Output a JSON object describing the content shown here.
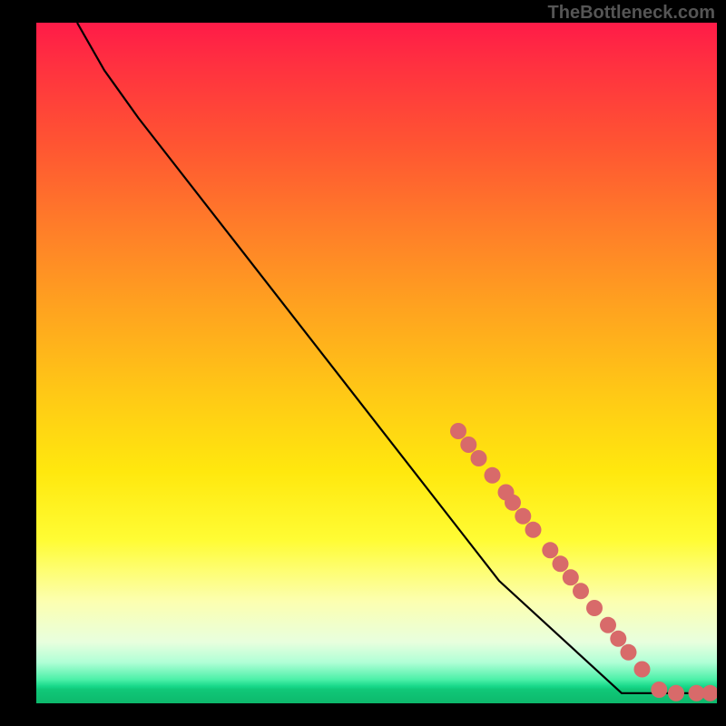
{
  "watermark": "TheBottleneck.com",
  "chart_data": {
    "type": "line",
    "title": "",
    "xlabel": "",
    "ylabel": "",
    "xlim": [
      0,
      100
    ],
    "ylim": [
      0,
      100
    ],
    "curve": [
      {
        "x": 6,
        "y": 100
      },
      {
        "x": 10,
        "y": 93
      },
      {
        "x": 15,
        "y": 86
      },
      {
        "x": 68,
        "y": 18
      },
      {
        "x": 86,
        "y": 1.5
      },
      {
        "x": 100,
        "y": 1.5
      }
    ],
    "markers": [
      {
        "x": 62,
        "y": 40
      },
      {
        "x": 63.5,
        "y": 38
      },
      {
        "x": 65,
        "y": 36
      },
      {
        "x": 67,
        "y": 33.5
      },
      {
        "x": 69,
        "y": 31
      },
      {
        "x": 70,
        "y": 29.5
      },
      {
        "x": 71.5,
        "y": 27.5
      },
      {
        "x": 73,
        "y": 25.5
      },
      {
        "x": 75.5,
        "y": 22.5
      },
      {
        "x": 77,
        "y": 20.5
      },
      {
        "x": 78.5,
        "y": 18.5
      },
      {
        "x": 80,
        "y": 16.5
      },
      {
        "x": 82,
        "y": 14
      },
      {
        "x": 84,
        "y": 11.5
      },
      {
        "x": 85.5,
        "y": 9.5
      },
      {
        "x": 87,
        "y": 7.5
      },
      {
        "x": 89,
        "y": 5
      },
      {
        "x": 91.5,
        "y": 2
      },
      {
        "x": 94,
        "y": 1.5
      },
      {
        "x": 97,
        "y": 1.5
      },
      {
        "x": 99,
        "y": 1.5
      }
    ],
    "marker_color": "#d86a6a",
    "marker_radius_pct": 1.2
  }
}
